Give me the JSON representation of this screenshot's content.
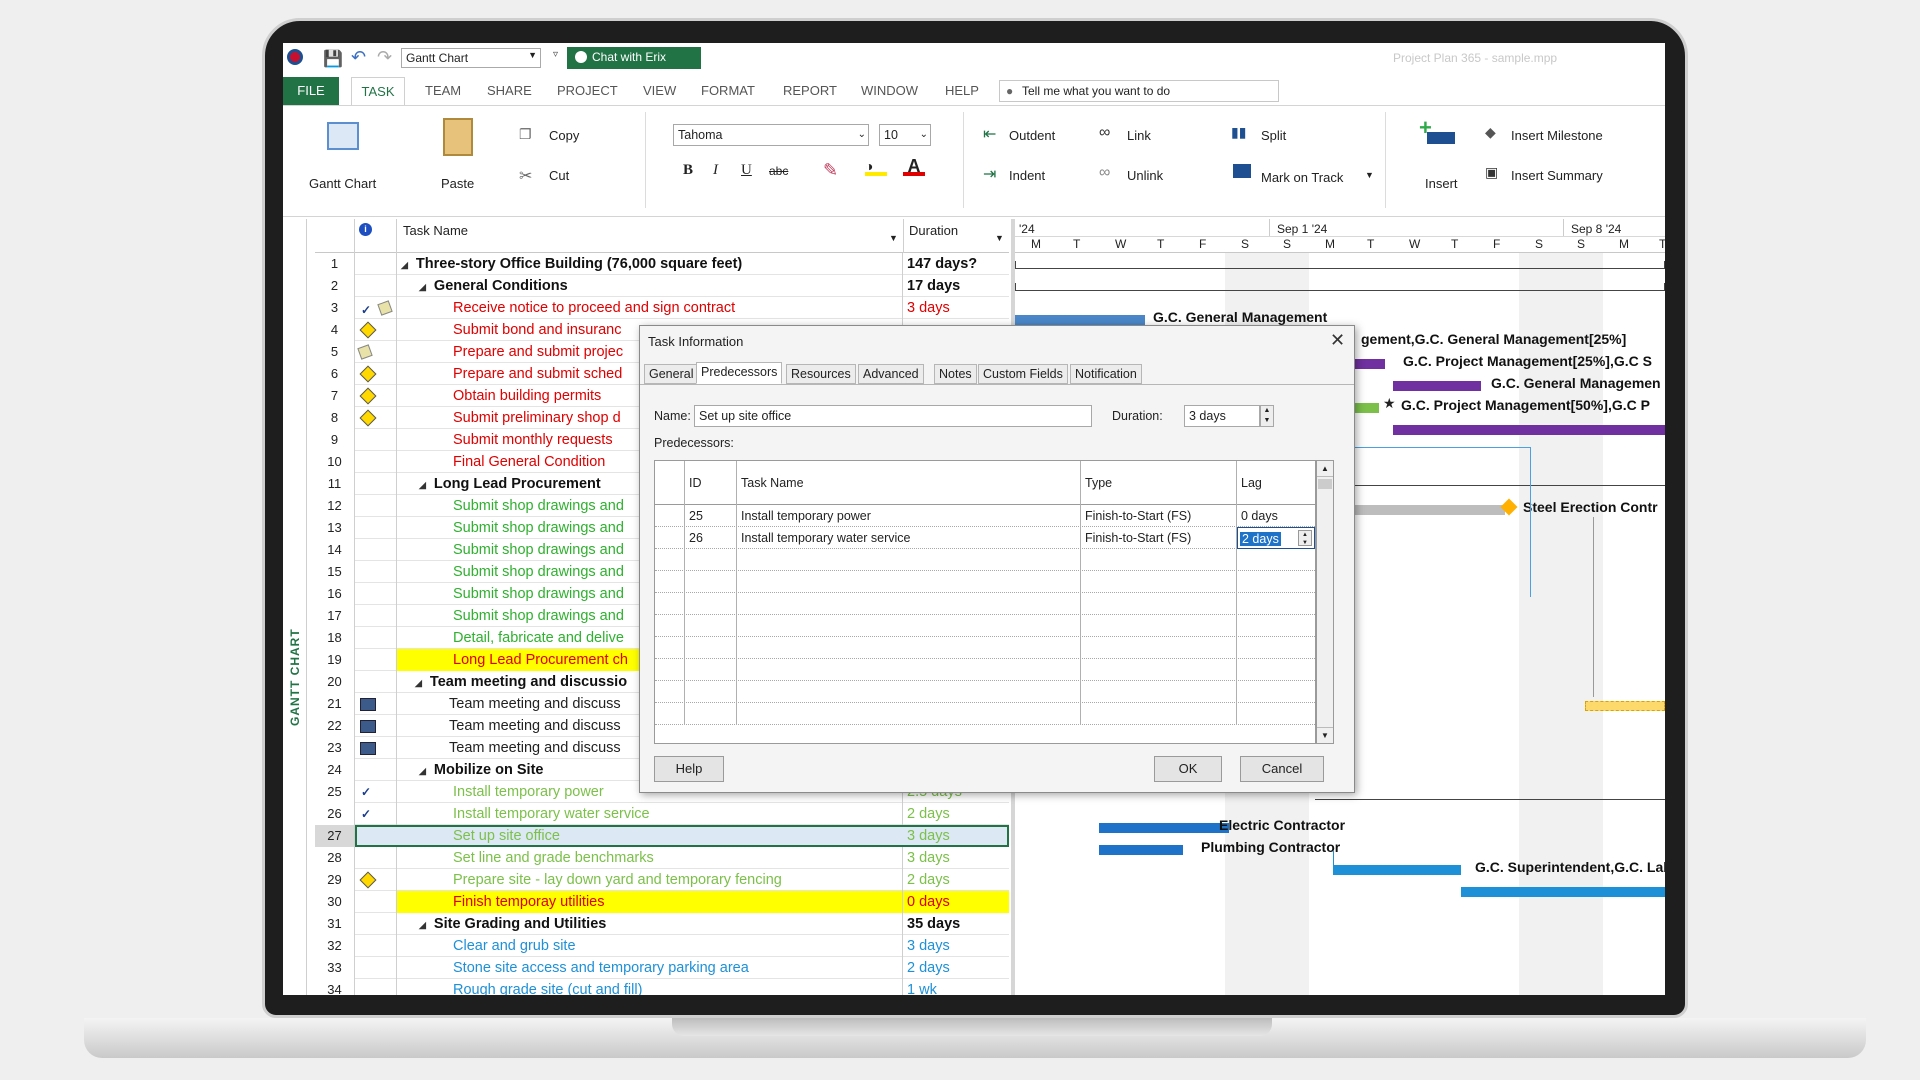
{
  "app": {
    "view_combo": "Gantt Chart",
    "chat_button": "Chat with Erix",
    "title": "Project Plan 365 - sample.mpp",
    "tell_me": "Tell me what you want to do"
  },
  "tabs": [
    "FILE",
    "TASK",
    "TEAM",
    "SHARE",
    "PROJECT",
    "VIEW",
    "FORMAT",
    "REPORT",
    "WINDOW",
    "HELP"
  ],
  "ribbon": {
    "gantt_chart": "Gantt Chart",
    "paste": "Paste",
    "copy": "Copy",
    "cut": "Cut",
    "font_name": "Tahoma",
    "font_size": "10",
    "bold": "B",
    "italic": "I",
    "underline": "U",
    "strike": "abc",
    "outdent": "Outdent",
    "indent": "Indent",
    "link": "Link",
    "unlink": "Unlink",
    "split": "Split",
    "mark_on_track": "Mark on Track",
    "insert": "Insert",
    "insert_milestone": "Insert Milestone",
    "insert_summary": "Insert Summary"
  },
  "side_label": "GANTT CHART",
  "grid": {
    "col_task_name": "Task Name",
    "col_duration": "Duration",
    "rows": [
      {
        "id": "1",
        "name": "Three-story Office Building (76,000 square feet)",
        "dur": "147 days?"
      },
      {
        "id": "2",
        "name": "General Conditions",
        "dur": "17 days"
      },
      {
        "id": "3",
        "name": "Receive notice to proceed and sign contract",
        "dur": "3 days"
      },
      {
        "id": "4",
        "name": "Submit bond and insuranc",
        "dur": ""
      },
      {
        "id": "5",
        "name": "Prepare and submit projec",
        "dur": ""
      },
      {
        "id": "6",
        "name": "Prepare and submit sched",
        "dur": ""
      },
      {
        "id": "7",
        "name": "Obtain building permits",
        "dur": ""
      },
      {
        "id": "8",
        "name": "Submit preliminary shop d",
        "dur": ""
      },
      {
        "id": "9",
        "name": "Submit monthly requests",
        "dur": ""
      },
      {
        "id": "10",
        "name": "Final General Condition",
        "dur": ""
      },
      {
        "id": "11",
        "name": "Long Lead Procurement",
        "dur": ""
      },
      {
        "id": "12",
        "name": "Submit shop drawings and",
        "dur": ""
      },
      {
        "id": "13",
        "name": "Submit shop drawings and",
        "dur": ""
      },
      {
        "id": "14",
        "name": "Submit shop drawings and",
        "dur": ""
      },
      {
        "id": "15",
        "name": "Submit shop drawings and",
        "dur": ""
      },
      {
        "id": "16",
        "name": "Submit shop drawings and",
        "dur": ""
      },
      {
        "id": "17",
        "name": "Submit shop drawings and",
        "dur": ""
      },
      {
        "id": "18",
        "name": "Detail, fabricate and delive",
        "dur": ""
      },
      {
        "id": "19",
        "name": "Long Lead Procurement ch",
        "dur": ""
      },
      {
        "id": "20",
        "name": "Team meeting and discussio",
        "dur": ""
      },
      {
        "id": "21",
        "name": "Team meeting and discuss",
        "dur": ""
      },
      {
        "id": "22",
        "name": "Team meeting and discuss",
        "dur": ""
      },
      {
        "id": "23",
        "name": "Team meeting and discuss",
        "dur": ""
      },
      {
        "id": "24",
        "name": "Mobilize on Site",
        "dur": ""
      },
      {
        "id": "25",
        "name": "Install temporary power",
        "dur": "2.5 days"
      },
      {
        "id": "26",
        "name": "Install temporary water service",
        "dur": "2 days"
      },
      {
        "id": "27",
        "name": "Set up site office",
        "dur": "3 days"
      },
      {
        "id": "28",
        "name": "Set line and grade benchmarks",
        "dur": "3 days"
      },
      {
        "id": "29",
        "name": "Prepare site - lay down yard and temporary fencing",
        "dur": "2 days"
      },
      {
        "id": "30",
        "name": "Finish temporay utilities",
        "dur": "0 days"
      },
      {
        "id": "31",
        "name": "Site Grading and Utilities",
        "dur": "35 days"
      },
      {
        "id": "32",
        "name": "Clear and grub site",
        "dur": "3 days"
      },
      {
        "id": "33",
        "name": "Stone site access and temporary parking area",
        "dur": "2 days"
      },
      {
        "id": "34",
        "name": "Rough grade site (cut and fill)",
        "dur": "1 wk"
      }
    ]
  },
  "timeline": {
    "weeks": [
      "'24",
      "Sep 1 '24",
      "Sep 8 '24"
    ],
    "days": [
      "M",
      "T",
      "W",
      "T",
      "F",
      "S",
      "S",
      "M",
      "T",
      "W",
      "T",
      "F",
      "S",
      "S",
      "M",
      "T"
    ],
    "labels": {
      "gc_mgmt": "G.C. General Management",
      "mgmt25": "gement,G.C. General Management[25%]",
      "proj25": "G.C. Project Management[25%],G.C S",
      "gc_mgmt2": "G.C. General Managemen",
      "proj50": "G.C. Project Management[50%],G.C P",
      "steel": "Steel Erection Contr",
      "electric": "Electric Contractor",
      "plumbing": "Plumbing Contractor",
      "superintendent": "G.C. Superintendent,G.C. Lab"
    }
  },
  "dialog": {
    "title": "Task Information",
    "tabs": [
      "General",
      "Predecessors",
      "Resources",
      "Advanced",
      "Notes",
      "Custom Fields",
      "Notification"
    ],
    "name_label": "Name:",
    "name_value": "Set up site office",
    "duration_label": "Duration:",
    "duration_value": "3 days",
    "predecessors_label": "Predecessors:",
    "table_headers": [
      "ID",
      "Task Name",
      "Type",
      "Lag"
    ],
    "rows": [
      {
        "id": "25",
        "name": "Install temporary power",
        "type": "Finish-to-Start (FS)",
        "lag": "0 days"
      },
      {
        "id": "26",
        "name": "Install temporary water service",
        "type": "Finish-to-Start (FS)",
        "lag": "2 days"
      }
    ],
    "help": "Help",
    "ok": "OK",
    "cancel": "Cancel"
  }
}
